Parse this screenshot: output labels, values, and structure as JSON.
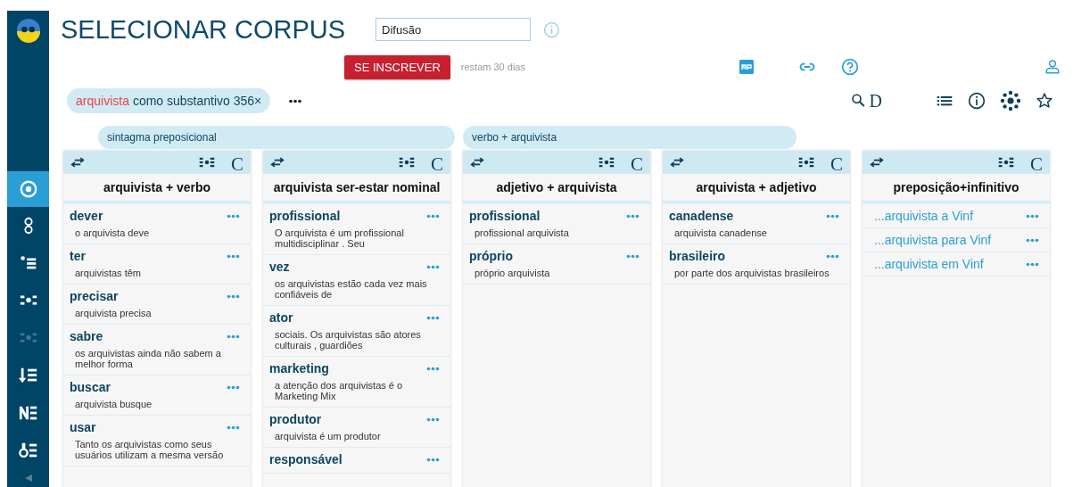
{
  "sidebar": {
    "items": [
      {
        "selected": true,
        "disabled": false
      },
      {
        "selected": false,
        "disabled": false
      },
      {
        "selected": false,
        "disabled": false
      },
      {
        "selected": false,
        "disabled": false
      },
      {
        "selected": false,
        "disabled": true
      },
      {
        "selected": false,
        "disabled": false
      },
      {
        "selected": false,
        "disabled": false
      },
      {
        "selected": false,
        "disabled": false
      }
    ]
  },
  "header": {
    "title": "SELECIONAR CORPUS",
    "corpus_field": {
      "value": "Difusão"
    },
    "subscribe_button": "SE INSCREVER",
    "trial_note": "restam 30 dias"
  },
  "query": {
    "chip": {
      "lemma": "arquivista",
      "text": "como substantivo 356×"
    },
    "toolbar_letter": "D"
  },
  "groups": [
    {
      "label": "sintagma preposicional"
    },
    {
      "label": "verbo + arquivista"
    }
  ],
  "columns": [
    {
      "kind": "collocation",
      "header_letter": "C",
      "title": "arquivista + verbo",
      "rows": [
        {
          "word": "dever",
          "example": "o arquivista deve"
        },
        {
          "word": "ter",
          "example": "arquivistas têm"
        },
        {
          "word": "precisar",
          "example": "arquivista precisa"
        },
        {
          "word": "sabre",
          "example": "os arquivistas ainda não sabem a melhor forma"
        },
        {
          "word": "buscar",
          "example": "arquivista busque"
        },
        {
          "word": "usar",
          "example": "Tanto os arquivistas como seus usuários utilizam a mesma versão"
        }
      ]
    },
    {
      "kind": "collocation",
      "header_letter": "C",
      "title": "arquivista ser-estar nominal",
      "rows": [
        {
          "word": "profissional",
          "example": "O arquivista é um profissional multidisciplinar . Seu"
        },
        {
          "word": "vez",
          "example": "os arquivistas estão cada vez mais confiáveis de"
        },
        {
          "word": "ator",
          "example": "sociais. Os arquivistas são atores culturais , guardiões"
        },
        {
          "word": "marketing",
          "example": "a atenção dos arquivistas é o Marketing Mix"
        },
        {
          "word": "produtor",
          "example": "arquivista é um produtor"
        },
        {
          "word": "responsável"
        }
      ]
    },
    {
      "kind": "collocation",
      "header_letter": "C",
      "title": "adjetivo + arquivista",
      "rows": [
        {
          "word": "profissional",
          "example": "profissional arquivista"
        },
        {
          "word": "próprio",
          "example": "próprio arquivista"
        }
      ]
    },
    {
      "kind": "collocation",
      "header_letter": "C",
      "title": "arquivista + adjetivo",
      "rows": [
        {
          "word": "canadense",
          "example": "arquivista canadense"
        },
        {
          "word": "brasileiro",
          "example": "por parte dos arquivistas brasileiros"
        }
      ]
    },
    {
      "kind": "link",
      "header_letter": "C",
      "title": "preposição+infinitivo",
      "rows": [
        {
          "word": "...arquivista a Vinf"
        },
        {
          "word": "...arquivista para Vinf"
        },
        {
          "word": "...arquivista em Vinf"
        }
      ]
    }
  ]
}
